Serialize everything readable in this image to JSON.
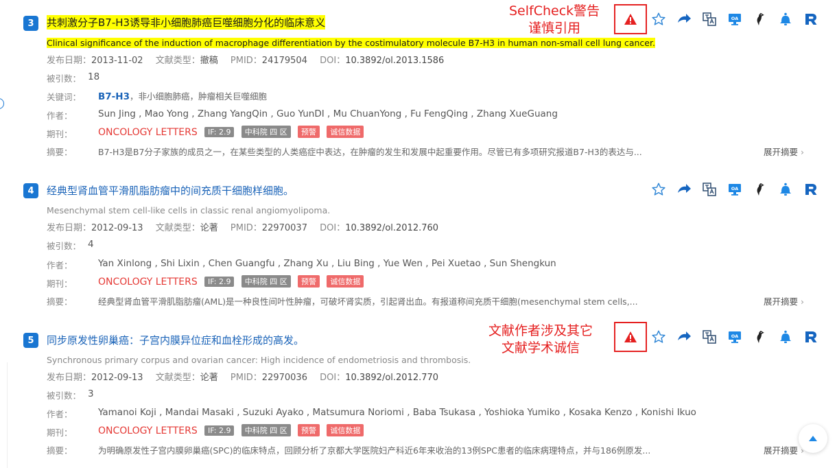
{
  "labels": {
    "date": "发布日期：",
    "doctype": "文献类型：",
    "pmid": "PMID：",
    "doi": "DOI：",
    "cited": "被引数：",
    "keywords": "关键词：",
    "authors": "作者：",
    "journal": "期刊：",
    "abstract": "摘要：",
    "expand": "展开摘要"
  },
  "records": [
    {
      "number": "3",
      "title": "共刺激分子B7-H3诱导非小细胞肺癌巨噬细胞分化的临床意义",
      "en_title": "Clinical significance of the induction of macrophage differentiation by the costimulatory molecule B7-H3 in human non-small cell lung cancer.",
      "date": "2013-11-02",
      "doctype": "撤稿",
      "pmid": "24179504",
      "doi": "10.3892/ol.2013.1586",
      "cited": "18",
      "keyword_main": "B7-H3",
      "keyword_rest": "，非小细胞肺癌，肿瘤相关巨噬细胞",
      "authors": "Sun Jing , Mao Yong , Zhang YangQin , Guo YunDI , Mu ChuanYong , Fu FengQing , Zhang XueGuang",
      "journal": "ONCOLOGY LETTERS",
      "tags": [
        "IF: 2.9",
        "中科院 四 区",
        "预警",
        "诚信数据"
      ],
      "abstract": "B7-H3是B7分子家族的成员之一，在某些类型的人类癌症中表达，在肿瘤的发生和发展中起重要作用。尽管已有多项研究报道B7-H3的表达与..."
    },
    {
      "number": "4",
      "title": "经典型肾血管平滑肌脂肪瘤中的间充质干细胞样细胞。",
      "en_title": "Mesenchymal stem cell-like cells in classic renal angiomyolipoma.",
      "date": "2012-09-13",
      "doctype": "论著",
      "pmid": "22970037",
      "doi": "10.3892/ol.2012.760",
      "cited": "4",
      "authors": "Yan Xinlong , Shi Lixin , Chen Guangfu , Zhang Xu , Liu Bing , Yue Wen , Pei Xuetao , Sun Shengkun",
      "journal": "ONCOLOGY LETTERS",
      "tags": [
        "IF: 2.9",
        "中科院 四 区",
        "预警",
        "诚信数据"
      ],
      "abstract": "经典型肾血管平滑肌脂肪瘤(AML)是一种良性间叶性肿瘤，可破坏肾实质，引起肾出血。有报道称间充质干细胞(mesenchymal stem cells,..."
    },
    {
      "number": "5",
      "title": "同步原发性卵巢癌：子宫内膜异位症和血栓形成的高发。",
      "en_title": "Synchronous primary corpus and ovarian cancer: High incidence of endometriosis and thrombosis.",
      "date": "2012-09-13",
      "doctype": "论著",
      "pmid": "22970036",
      "doi": "10.3892/ol.2012.770",
      "cited": "3",
      "authors": "Yamanoi Koji , Mandai Masaki , Suzuki Ayako , Matsumura Noriomi , Baba Tsukasa , Yoshioka Yumiko , Kosaka Kenzo , Konishi Ikuo",
      "journal": "ONCOLOGY LETTERS",
      "tags": [
        "IF: 2.9",
        "中科院 四 区",
        "预警",
        "诚信数据"
      ],
      "abstract": "为明确原发性子宫内膜卵巢癌(SPC)的临床特点，回顾分析了京都大学医院妇产科近6年来收治的13例SPC患者的临床病理特点，并与186例原发..."
    }
  ],
  "annotations": {
    "first_line1": "SelfCheck警告",
    "first_line2": "谨慎引用",
    "second_line1": "文献作者涉及其它",
    "second_line2": "文献学术诚信"
  },
  "icon_names": [
    "warning-icon",
    "star-icon",
    "share-arrow-icon",
    "translate-icon",
    "open-access-icon",
    "bird-icon",
    "bell-icon",
    "r-logo-icon"
  ],
  "colors": {
    "accent": "#1976d2",
    "title_blue": "#1a63b8",
    "highlight": "#ffff00",
    "journal_red": "#e53935",
    "annotation_red": "#e52020"
  }
}
